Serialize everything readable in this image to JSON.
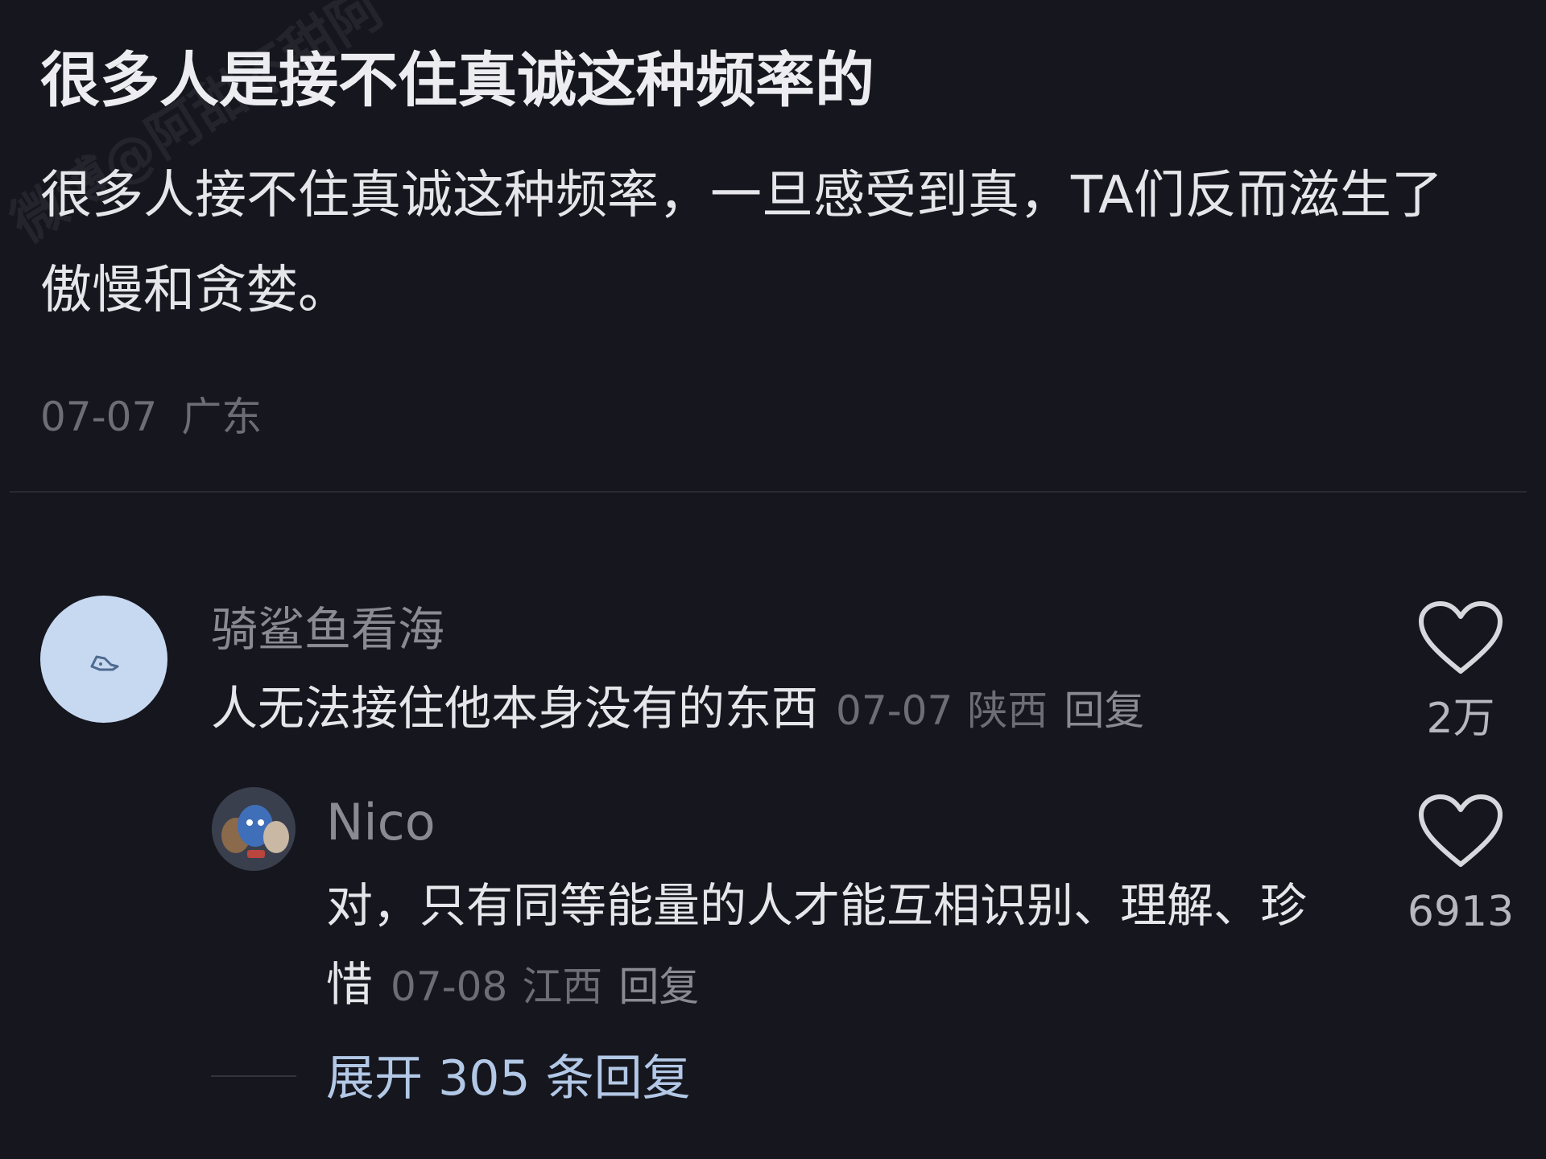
{
  "post": {
    "title": "很多人是接不住真诚这种频率的",
    "body": "很多人接不住真诚这种频率，一旦感受到真，TA们反而滋生了傲慢和贪婪。",
    "date": "07-07",
    "location": "广东"
  },
  "watermark": "微博@阿甜不甜阿",
  "comments": [
    {
      "username": "骑鲨鱼看海",
      "text": "人无法接住他本身没有的东西",
      "date": "07-07",
      "location": "陕西",
      "reply_label": "回复",
      "likes": "2万",
      "avatar_color": "#c7d9f1",
      "like_icon": "heart-outline-icon"
    },
    {
      "username": "Nico",
      "text": "对，只有同等能量的人才能互相识别、理解、珍惜",
      "date": "07-08",
      "location": "江西",
      "reply_label": "回复",
      "likes": "6913",
      "like_icon": "heart-outline-icon"
    }
  ],
  "expand_replies": "展开 305 条回复",
  "colors": {
    "background": "#16161e",
    "primary_text": "#e6e6ea",
    "muted_text": "#6d6d76",
    "username_text": "#8a8a93",
    "link_text": "#b2c8e6"
  }
}
